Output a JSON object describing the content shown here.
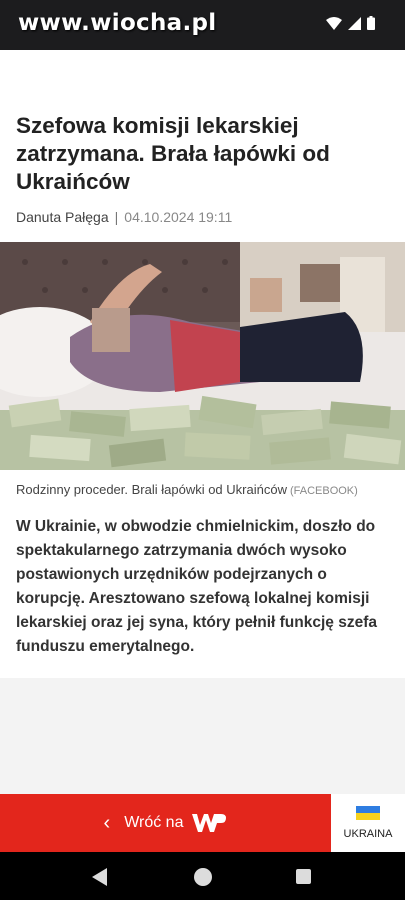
{
  "status_bar": {
    "watermark": "www.wiocha.pl",
    "icons": [
      "wifi-icon",
      "signal-icon",
      "battery-icon"
    ]
  },
  "article": {
    "title": "Szefowa komisji lekarskiej zatrzymana. Brała łapówki od Ukraińców",
    "author": "Danuta Pałęga",
    "separator": "|",
    "date": "04.10.2024 19:11",
    "photo_caption": "Rodzinny proceder. Brali łapówki od Ukraińców",
    "photo_source": "(FACEBOOK)",
    "lead": "W Ukrainie, w obwodzie chmielnickim, doszło do spektakularnego zatrzymania dwóch wysoko postawionych urzędników podejrzanych o korupcję. Aresztowano szefową lokalnej komisji lekarskiej oraz jej syna, który pełnił funkcję szefa funduszu emerytalnego."
  },
  "bottom_bar": {
    "back_label": "Wróć na",
    "brand": "WP",
    "ukraine_label": "UKRAINA"
  },
  "colors": {
    "accent_red": "#e3261c",
    "flag_blue": "#2e7de1",
    "flag_yellow": "#f6d21d"
  }
}
